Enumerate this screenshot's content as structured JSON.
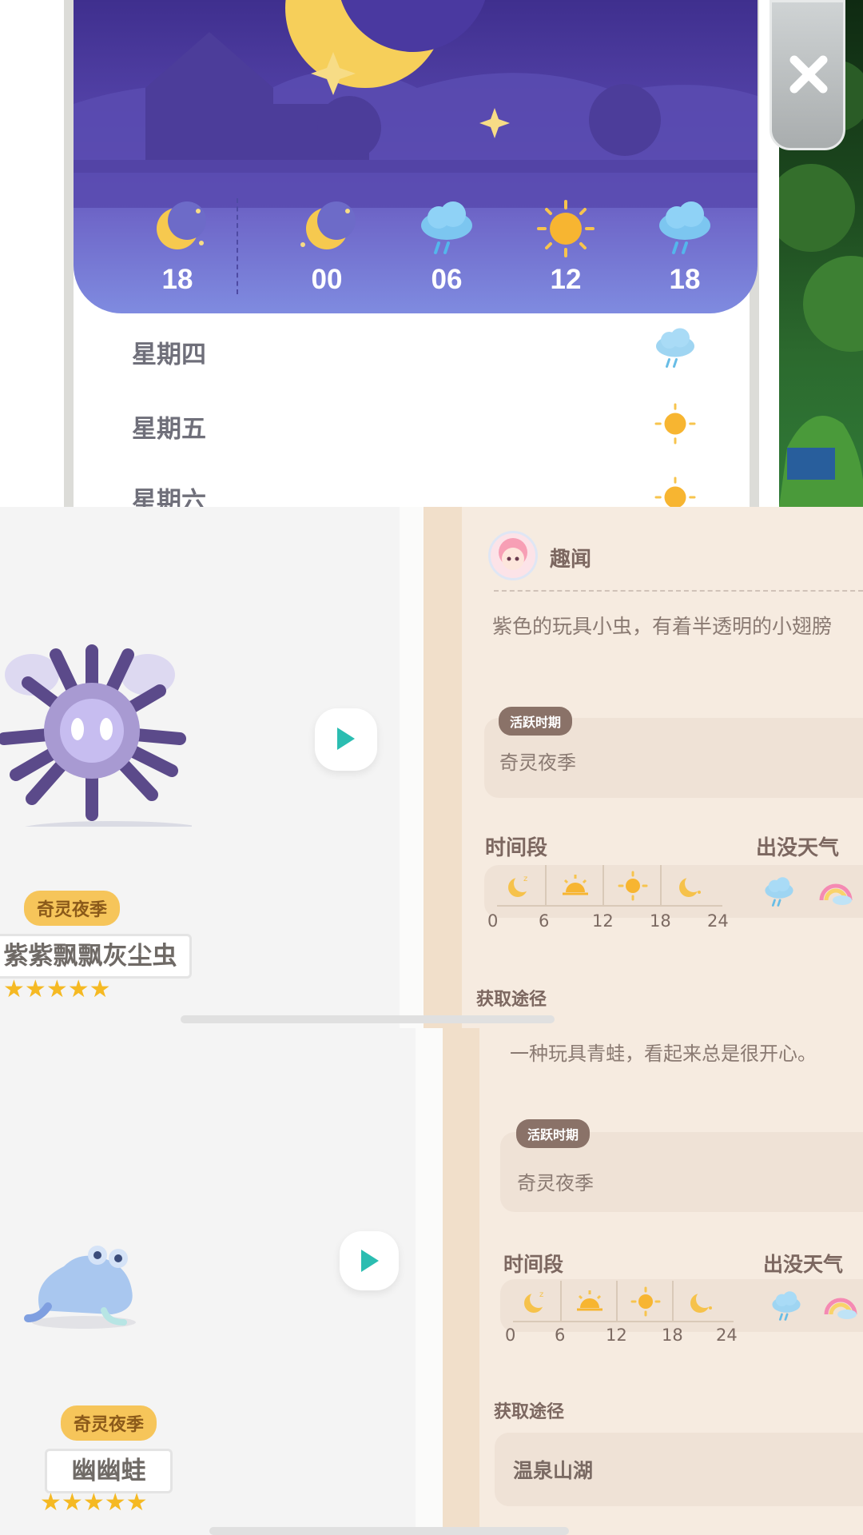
{
  "weather": {
    "hourly": [
      {
        "hour": "18",
        "icon": "moon-icon"
      },
      {
        "hour": "00",
        "icon": "moon-icon"
      },
      {
        "hour": "06",
        "icon": "rain-cloud-icon"
      },
      {
        "hour": "12",
        "icon": "sun-icon"
      },
      {
        "hour": "18",
        "icon": "rain-cloud-icon"
      }
    ],
    "daily": [
      {
        "day": "星期四",
        "icon": "rain-cloud-icon"
      },
      {
        "day": "星期五",
        "icon": "sun-icon"
      },
      {
        "day": "星期六",
        "icon": "sun-icon"
      }
    ]
  },
  "insect": {
    "name": "紫紫飘飘灰尘虫",
    "season_badge": "奇灵夜季",
    "stars": 5,
    "trivia_title": "趣闻",
    "description": "紫色的玩具小虫，有着半透明的小翅膀",
    "active_period_label": "活跃时期",
    "active_period_value": "奇灵夜季",
    "time_label": "时间段",
    "weather_label": "出没天气",
    "acquire_label": "获取途径",
    "time_ticks": [
      "0",
      "6",
      "12",
      "18",
      "24"
    ]
  },
  "frog": {
    "name": "幽幽蛙",
    "season_badge": "奇灵夜季",
    "stars": 5,
    "description": "一种玩具青蛙，看起来总是很开心。",
    "active_period_label": "活跃时期",
    "active_period_value": "奇灵夜季",
    "time_label": "时间段",
    "weather_label": "出没天气",
    "acquire_label": "获取途径",
    "acquire_value": "温泉山湖",
    "time_ticks": [
      "0",
      "6",
      "12",
      "18",
      "24"
    ]
  },
  "colors": {
    "accent_teal": "#2bbdb1",
    "star": "#f5b923",
    "season_badge": "#f6c55a",
    "night_sky": "#5847ae"
  }
}
